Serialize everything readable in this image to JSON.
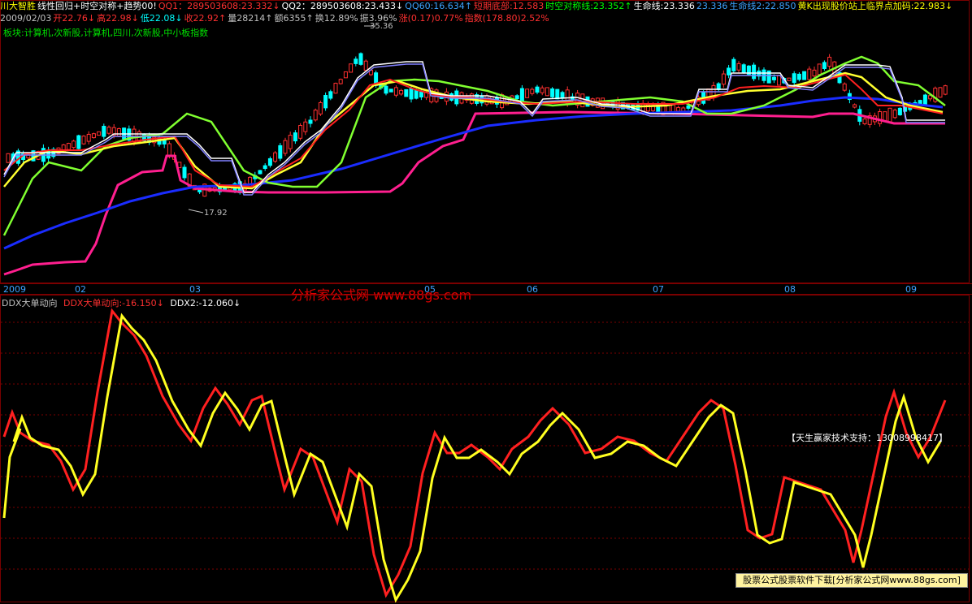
{
  "header": {
    "items": [
      {
        "text": "川大智胜",
        "color": "#ffff00"
      },
      {
        "text": "线性回归+时空对称+趋势00!",
        "color": "#ffffff"
      },
      {
        "text": "QQ1：289503608:23.332↓",
        "color": "#ff3030"
      },
      {
        "text": "QQ2：289503608:23.433↓",
        "color": "#ffffff"
      },
      {
        "text": "QQ60:16.634↑",
        "color": "#3da3ff"
      },
      {
        "text": "短期底部:12.583",
        "color": "#ff3030"
      },
      {
        "text": "时空对称线:23.352↑",
        "color": "#00ff00"
      },
      {
        "text": "生命线:23.336",
        "color": "#ffffff"
      },
      {
        "text": "23.336",
        "color": "#3da3ff"
      },
      {
        "text": "生命线2:22.850",
        "color": "#3da3ff"
      },
      {
        "text": "黄K出现股价站上临界点加码:22.983↓",
        "color": "#ffff00"
      }
    ],
    "row2": [
      {
        "text": "2009/02/03",
        "color": "#c0c0c0"
      },
      {
        "text": "开22.76↓",
        "color": "#ff3030"
      },
      {
        "text": "高22.98↓",
        "color": "#ff3030"
      },
      {
        "text": "低22.08↓",
        "color": "#00ffff"
      },
      {
        "text": "收22.92↑",
        "color": "#ff3030"
      },
      {
        "text": "量28214↑",
        "color": "#c0c0c0"
      },
      {
        "text": "额6355↑",
        "color": "#c0c0c0"
      },
      {
        "text": "换12.89%",
        "color": "#c0c0c0"
      },
      {
        "text": "振3.96%",
        "color": "#c0c0c0"
      },
      {
        "text": "涨(0.17)0.77%",
        "color": "#ff3030"
      },
      {
        "text": "指数(178.80)2.52%",
        "color": "#ff3030"
      }
    ],
    "sector": "板块:计算机,次新股,计算机,四川,次新股,中小板指数"
  },
  "price_labels": {
    "high": "35.36",
    "low": "17.92"
  },
  "axis": {
    "labels": [
      "2009",
      "02",
      "03",
      "05",
      "06",
      "07",
      "08",
      "09"
    ]
  },
  "indicator": {
    "title": "DDX大单动向",
    "line1": "DDX大单动向:-16.150↓",
    "line2": "DDX2:-12.060↓",
    "colors": {
      "line1": "#ff2020",
      "line2": "#ffff20"
    }
  },
  "watermark": "分析家公式网 www.88gs.com",
  "support": "【天生赢家技术支持：13008998417】",
  "footer_link": "股票公式股票软件下载[分析家公式网www.88gs.com]",
  "colors": {
    "bg": "#000000",
    "frame": "#7a0000",
    "up": "#ff3030",
    "down": "#00ffff"
  }
}
